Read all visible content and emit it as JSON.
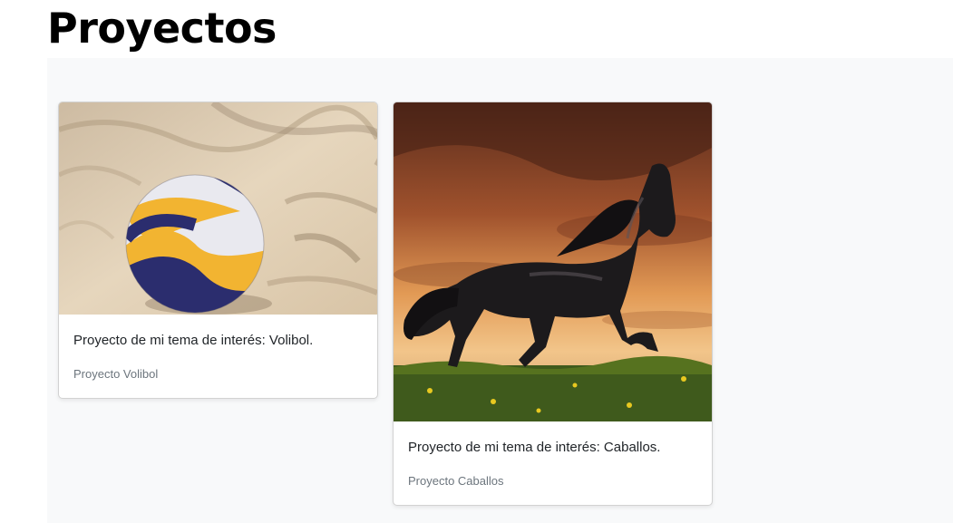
{
  "page": {
    "title": "Proyectos"
  },
  "projects": [
    {
      "image": "volleyball-on-sand",
      "description": "Proyecto de mi tema de interés: Volibol.",
      "caption": "Proyecto Volibol"
    },
    {
      "image": "black-horse-at-sunset",
      "description": "Proyecto de mi tema de interés: Caballos.",
      "caption": "Proyecto Caballos"
    }
  ],
  "colors": {
    "album_background": "#f8f9fa",
    "card_background": "#ffffff",
    "text": "#212529",
    "muted_text": "#6c757d"
  }
}
